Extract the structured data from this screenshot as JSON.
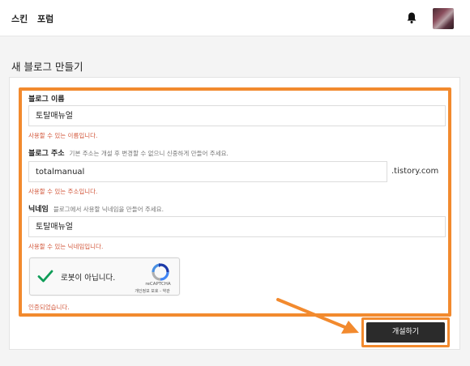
{
  "topbar": {
    "nav": [
      "스킨",
      "포럼"
    ]
  },
  "page": {
    "title": "새 블로그 만들기"
  },
  "form": {
    "blog_name": {
      "label": "블로그 이름",
      "value": "토탈매뉴얼",
      "validation": "사용할 수 있는 이름입니다."
    },
    "blog_address": {
      "label": "블로그 주소",
      "hint": "기본 주소는 개설 후 변경할 수 없으니 신중하게 만들어 주세요.",
      "value": "totalmanual",
      "suffix": ".tistory.com",
      "validation": "사용할 수 있는 주소입니다."
    },
    "nickname": {
      "label": "닉네임",
      "hint": "블로그에서 사용할 닉네임을 만들어 주세요.",
      "value": "토탈매뉴얼",
      "validation": "사용할 수 있는 닉네임입니다."
    },
    "recaptcha": {
      "label": "로봇이 아닙니다.",
      "brand": "reCAPTCHA",
      "links": "개인정보 보호 - 약관",
      "checked": true
    },
    "verified_text": "인증되었습니다.",
    "submit_label": "개설하기"
  },
  "colors": {
    "annotation": "#f28a2e",
    "validation": "#d35a3e",
    "button": "#2b2b2b"
  }
}
